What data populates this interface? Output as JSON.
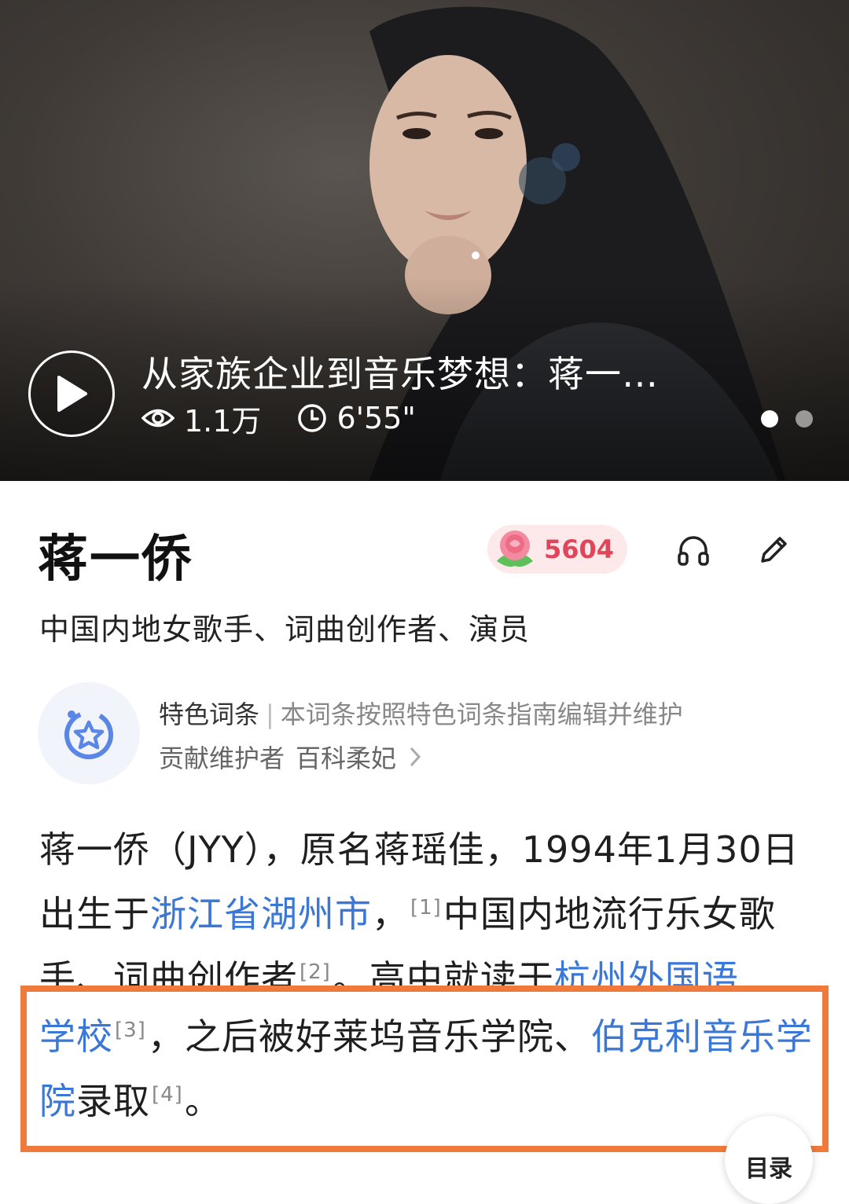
{
  "video": {
    "title": "从家族企业到音乐梦想：蒋一…",
    "views": "1.1万",
    "duration": "6'55\"",
    "slide_count": 2,
    "active_slide": 1
  },
  "entry": {
    "title": "蒋一侨",
    "flower_count": "5604",
    "subtitle": "中国内地女歌手、词曲创作者、演员"
  },
  "feature": {
    "label": "特色词条",
    "description": "本词条按照特色词条指南编辑并维护",
    "contributor_label": "贡献维护者",
    "contributor_name": "百科柔妃"
  },
  "intro": {
    "p1": "蒋一侨（JYY），原名蒋瑶佳，1994年1月30日出生于",
    "link1": "浙江省湖州市",
    "p2": "，",
    "ref1": "[1]",
    "p3": "中国内地流行乐女歌手、词曲创作者",
    "ref2": "[2]",
    "p4": "。高中就读于",
    "link2a": "杭州外国语",
    "link2b": "学校",
    "ref3": "[3]",
    "p5": "，之后被好莱坞音乐学院、",
    "link3": "伯克利音乐学院",
    "p6": "录取",
    "ref4": "[4]",
    "p7": "。"
  },
  "toc_label": "目录",
  "colors": {
    "link": "#3b77d6",
    "highlight_border": "#f07a3b",
    "flower_badge_bg": "#fde9ea",
    "flower_count": "#e0455a"
  },
  "icons": {
    "play": "play-icon",
    "views": "eye-icon",
    "duration": "clock-icon",
    "flower": "rose-icon",
    "listen": "headphones-icon",
    "edit": "pencil-icon",
    "feature": "star-badge-icon",
    "more": "chevron-right-icon"
  }
}
